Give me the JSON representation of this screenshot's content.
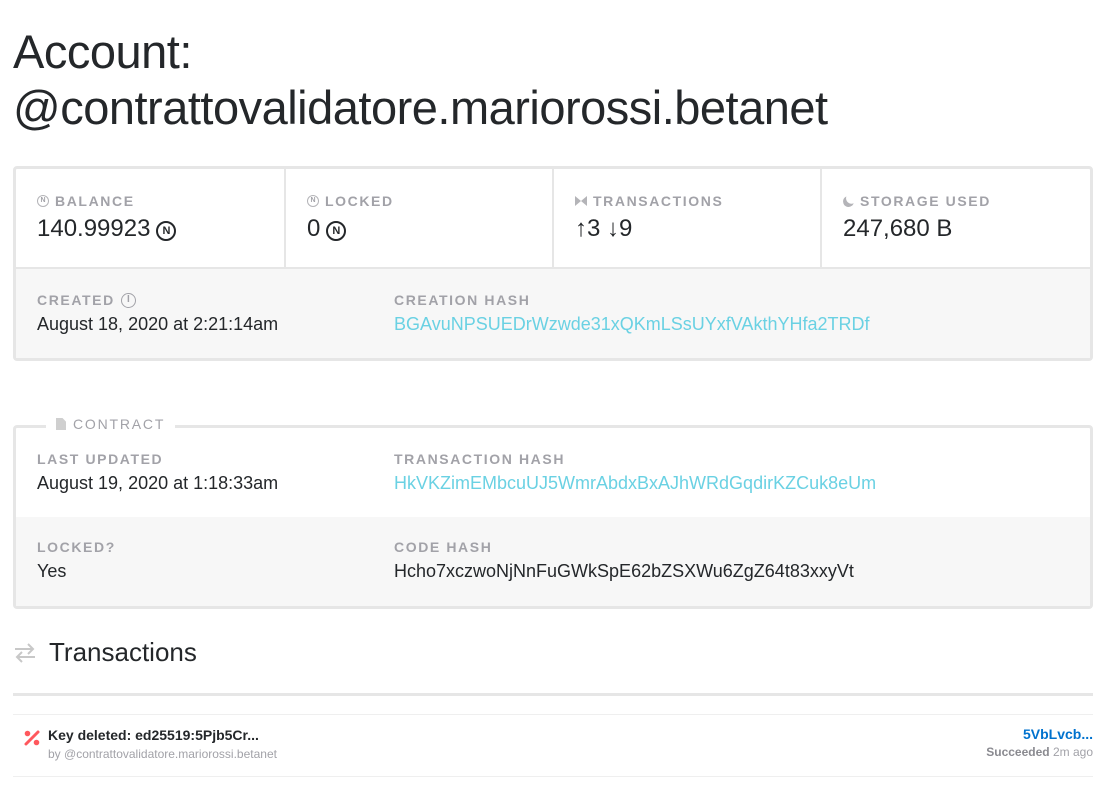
{
  "page": {
    "title_line1": "Account:",
    "title_line2": "@contrattovalidatore.mariorossi.betanet"
  },
  "summary": {
    "balance": {
      "label": "BALANCE",
      "value": "140.99923",
      "unit_symbol": "N"
    },
    "locked": {
      "label": "LOCKED",
      "value": "0",
      "unit_symbol": "N"
    },
    "transactions": {
      "label": "TRANSACTIONS",
      "value": "↑3 ↓9"
    },
    "storage": {
      "label": "STORAGE USED",
      "value": "247,680 B"
    }
  },
  "details": {
    "created_label": "CREATED",
    "created_value": "August 18, 2020 at 2:21:14am",
    "creation_hash_label": "CREATION HASH",
    "creation_hash_value": "BGAvuNPSUEDrWzwde31xQKmLSsUYxfVAkthYHfa2TRDf"
  },
  "contract": {
    "legend": "CONTRACT",
    "last_updated_label": "LAST UPDATED",
    "last_updated_value": "August 19, 2020 at 1:18:33am",
    "tx_hash_label": "TRANSACTION HASH",
    "tx_hash_value": "HkVKZimEMbcuUJ5WmrAbdxBxAJhWRdGqdirKZCuk8eUm",
    "locked_label": "LOCKED?",
    "locked_value": "Yes",
    "code_hash_label": "CODE HASH",
    "code_hash_value": "Hcho7xczwoNjNnFuGWkSpE62bZSXWu6ZgZ64t83xxyVt"
  },
  "transactions": {
    "heading": "Transactions",
    "items": [
      {
        "icon": "key-delete-icon",
        "title": "Key deleted: ed25519:5Pjb5Cr...",
        "by": "by @contrattovalidatore.mariorossi.betanet",
        "hash": "5VbLvcb...",
        "status": "Succeeded",
        "time": "2m ago"
      }
    ]
  },
  "colors": {
    "link": "#6ad1e3",
    "hash_link": "#0072ce",
    "label": "#a2a2a8",
    "danger": "#ff585d"
  }
}
